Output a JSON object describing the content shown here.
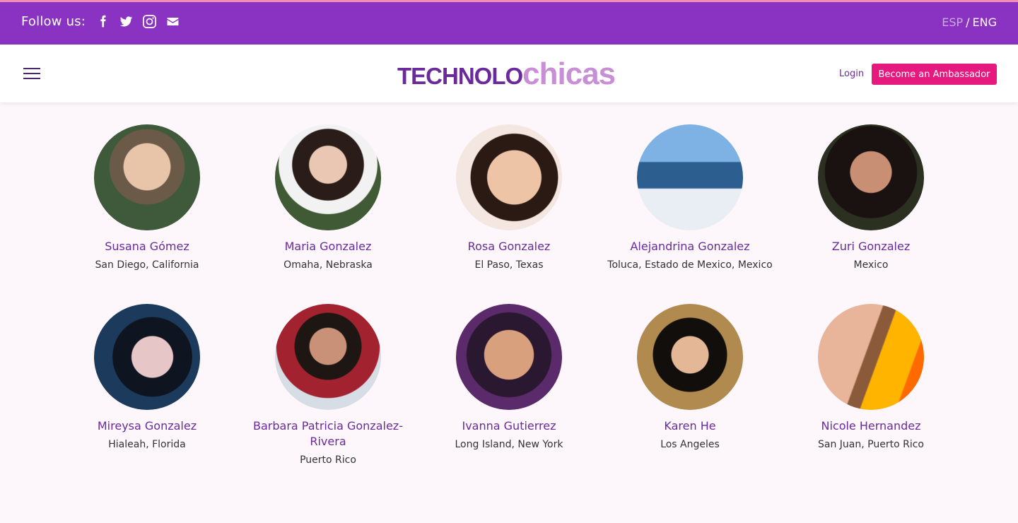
{
  "topbar": {
    "follow_label": "Follow us:",
    "social": [
      "facebook-icon",
      "twitter-icon",
      "instagram-icon",
      "mail-icon"
    ],
    "lang_esp": "ESP",
    "lang_sep": "/",
    "lang_eng": "ENG",
    "bg_color": "#8a33c2"
  },
  "header": {
    "logo_part1": "TECHNOLO",
    "logo_part2": "chicas",
    "login": "Login",
    "ambassador": "Become an Ambassador",
    "accent_color": "#e5197e"
  },
  "ambassadors": [
    {
      "name": "Susana Gómez",
      "location": "San Diego, California"
    },
    {
      "name": "Maria Gonzalez",
      "location": "Omaha, Nebraska"
    },
    {
      "name": "Rosa Gonzalez",
      "location": "El Paso, Texas"
    },
    {
      "name": "Alejandrina Gonzalez",
      "location": "Toluca, Estado de Mexico, Mexico"
    },
    {
      "name": "Zuri Gonzalez",
      "location": "Mexico"
    },
    {
      "name": "Mireysa Gonzalez",
      "location": "Hialeah, Florida"
    },
    {
      "name": "Barbara Patricia Gonzalez-Rivera",
      "location": "Puerto Rico"
    },
    {
      "name": "Ivanna Gutierrez",
      "location": "Long Island, New York"
    },
    {
      "name": "Karen He",
      "location": "Los Angeles"
    },
    {
      "name": "Nicole Hernandez",
      "location": "San Juan, Puerto Rico"
    }
  ]
}
